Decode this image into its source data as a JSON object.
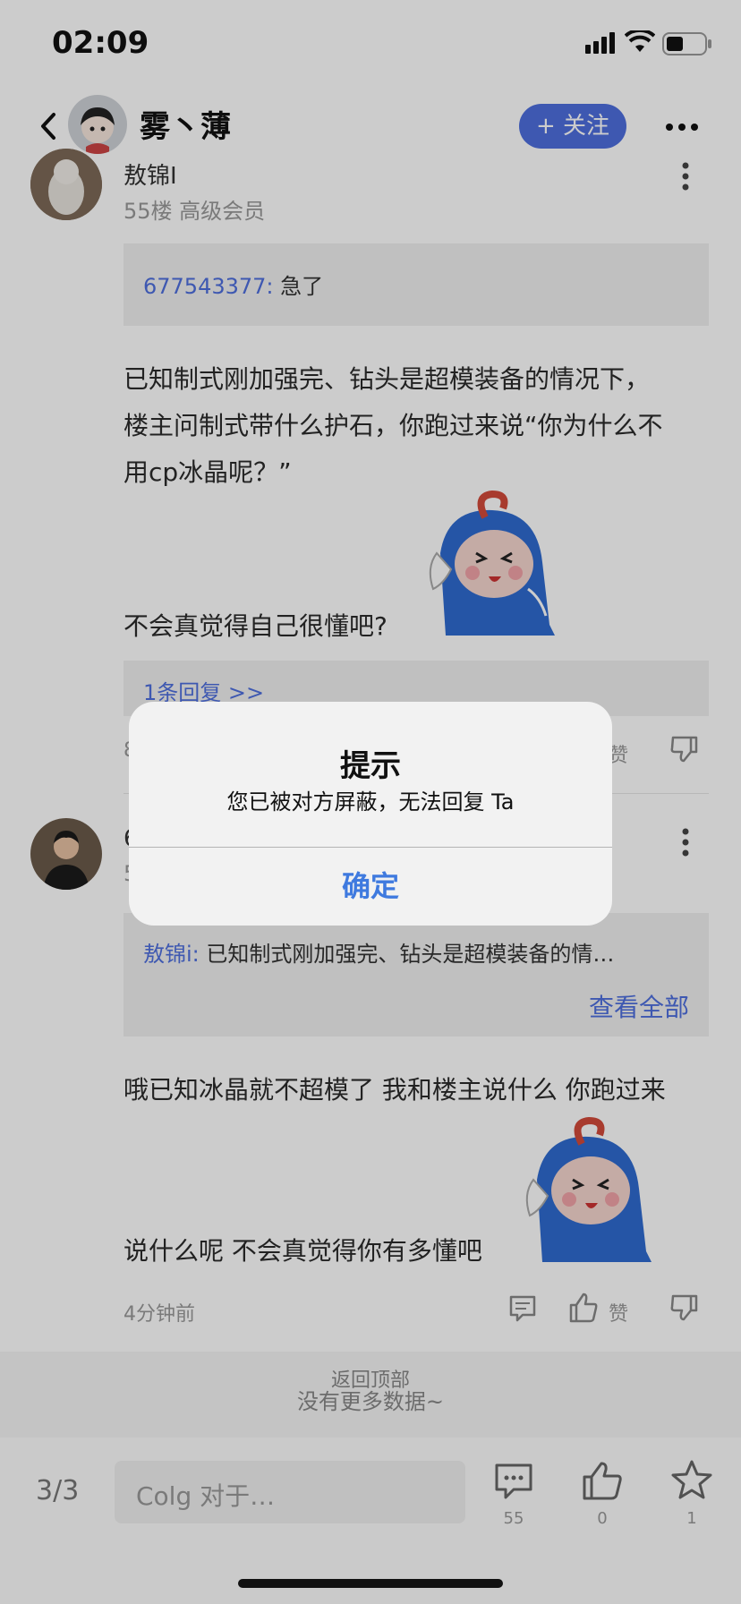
{
  "status_bar": {
    "time": "02:09"
  },
  "nav": {
    "name": "雾丶薄",
    "follow_label": "+ 关注"
  },
  "post1": {
    "author": "敖锦I",
    "meta": "55楼 高级会员",
    "quote_user": "677543377:",
    "quote_text": "急了",
    "text_lines": [
      "已知制式刚加强完、钻头是超模装备的情况下，",
      "楼主问制式带什么护石，你跑过来说“你为什么不",
      "用cp冰晶呢？”"
    ],
    "text_after_sticker": "不会真觉得自己很懂吧?",
    "replies_link": "1条回复 >>",
    "meta_partial": "8",
    "like_label": "赞"
  },
  "post2": {
    "author_partial": "6",
    "meta_partial": "5",
    "quote_user": "敖锦i:",
    "quote_text": "已知制式刚加强完、钻头是超模装备的情…",
    "view_all": "查看全部",
    "text_line1": "哦已知冰晶就不超模了 我和楼主说什么 你跑过来",
    "text_line2": "说什么呢 不会真觉得你有多懂吧",
    "time": "4分钟前",
    "like_label": "赞"
  },
  "back_to_top": "返回顶部",
  "no_more": "没有更多数据~",
  "bottom_bar": {
    "page": "3/3",
    "input_placeholder": "Colg 对于…",
    "comments_count": "55",
    "likes_count": "0",
    "favorites_count": "1"
  },
  "dialog": {
    "title": "提示",
    "message": "您已被对方屏蔽，无法回复 Ta",
    "ok_label": "确定"
  }
}
